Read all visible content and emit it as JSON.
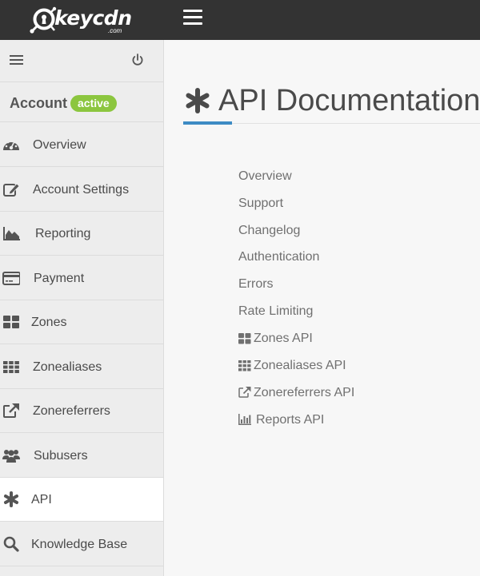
{
  "brand": {
    "name": "keycdn",
    "sub": ".com",
    "logo_icon": "keyhole-logo-icon"
  },
  "topbar": {
    "menu_icon": "hamburger-icon"
  },
  "sidebar": {
    "menu_icon": "hamburger-icon",
    "power_icon": "power-icon",
    "account_label": "Account",
    "account_status": "active",
    "items": [
      {
        "label": "Overview",
        "icon": "dashboard-icon"
      },
      {
        "label": "Account Settings",
        "icon": "edit-icon"
      },
      {
        "label": "Reporting",
        "icon": "area-chart-icon"
      },
      {
        "label": "Payment",
        "icon": "credit-card-icon"
      },
      {
        "label": "Zones",
        "icon": "th-large-icon"
      },
      {
        "label": "Zonealiases",
        "icon": "th-icon"
      },
      {
        "label": "Zonereferrers",
        "icon": "external-link-icon"
      },
      {
        "label": "Subusers",
        "icon": "users-icon"
      },
      {
        "label": "API",
        "icon": "asterisk-icon",
        "active": true
      },
      {
        "label": "Knowledge Base",
        "icon": "search-icon"
      }
    ]
  },
  "main": {
    "title": "API Documentation",
    "title_icon": "asterisk-icon",
    "links": [
      {
        "label": "Overview"
      },
      {
        "label": "Support"
      },
      {
        "label": "Changelog"
      },
      {
        "label": "Authentication"
      },
      {
        "label": "Errors"
      },
      {
        "label": "Rate Limiting"
      },
      {
        "label": "Zones API",
        "icon": "th-large-icon"
      },
      {
        "label": "Zonealiases API",
        "icon": "th-icon"
      },
      {
        "label": "Zonereferrers API",
        "icon": "external-link-icon"
      },
      {
        "label": "Reports API",
        "icon": "bar-chart-icon"
      }
    ]
  },
  "colors": {
    "topbar": "#333333",
    "badge": "#8cc63f",
    "accent": "#3d8bc4",
    "sidebar": "#ededed"
  }
}
